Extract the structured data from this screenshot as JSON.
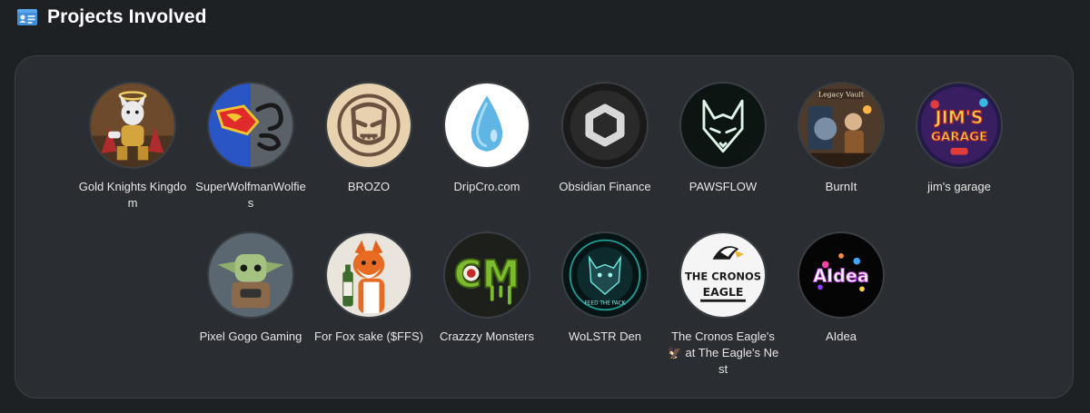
{
  "header": {
    "title": "Projects Involved",
    "icon": "id-card-icon"
  },
  "projects": [
    {
      "name": "Gold Knights Kingdom",
      "icon": "gold-knights-kingdom-logo"
    },
    {
      "name": "SuperWolfmanWolfies",
      "icon": "superwolfman-logo"
    },
    {
      "name": "BROZO",
      "icon": "brozo-logo"
    },
    {
      "name": "DripCro.com",
      "icon": "water-drop-logo"
    },
    {
      "name": "Obsidian Finance",
      "icon": "obsidian-hexagon-logo"
    },
    {
      "name": "PAWSFLOW",
      "icon": "wolf-outline-logo"
    },
    {
      "name": "BurnIt",
      "icon": "burnit-legacy-vault-logo",
      "logo_text": "Legacy Vault"
    },
    {
      "name": "jim's garage",
      "icon": "jims-garage-logo",
      "logo_text": "JIM'S GARAGE"
    },
    {
      "name": "Pixel Gogo Gaming",
      "icon": "pixel-gogo-logo"
    },
    {
      "name": "For Fox sake ($FFS)",
      "icon": "fox-logo"
    },
    {
      "name": "Crazzzy Monsters",
      "icon": "crazzzy-monsters-logo",
      "logo_text": "CM"
    },
    {
      "name": "WoLSTR Den",
      "icon": "wolf-den-logo",
      "logo_text": "FEED THE PACK"
    },
    {
      "name": "The Cronos Eagle's 🦅 at The Eagle's Nest",
      "icon": "cronos-eagle-logo",
      "logo_text": "THE CRONOS EAGLE"
    },
    {
      "name": "AIdea",
      "icon": "aidea-logo",
      "logo_text": "AIdea"
    }
  ],
  "colors": {
    "page_background": "#1e2124",
    "panel_background": "#2a2d31",
    "panel_border": "#3b4146",
    "text": "#e6e6e6"
  }
}
